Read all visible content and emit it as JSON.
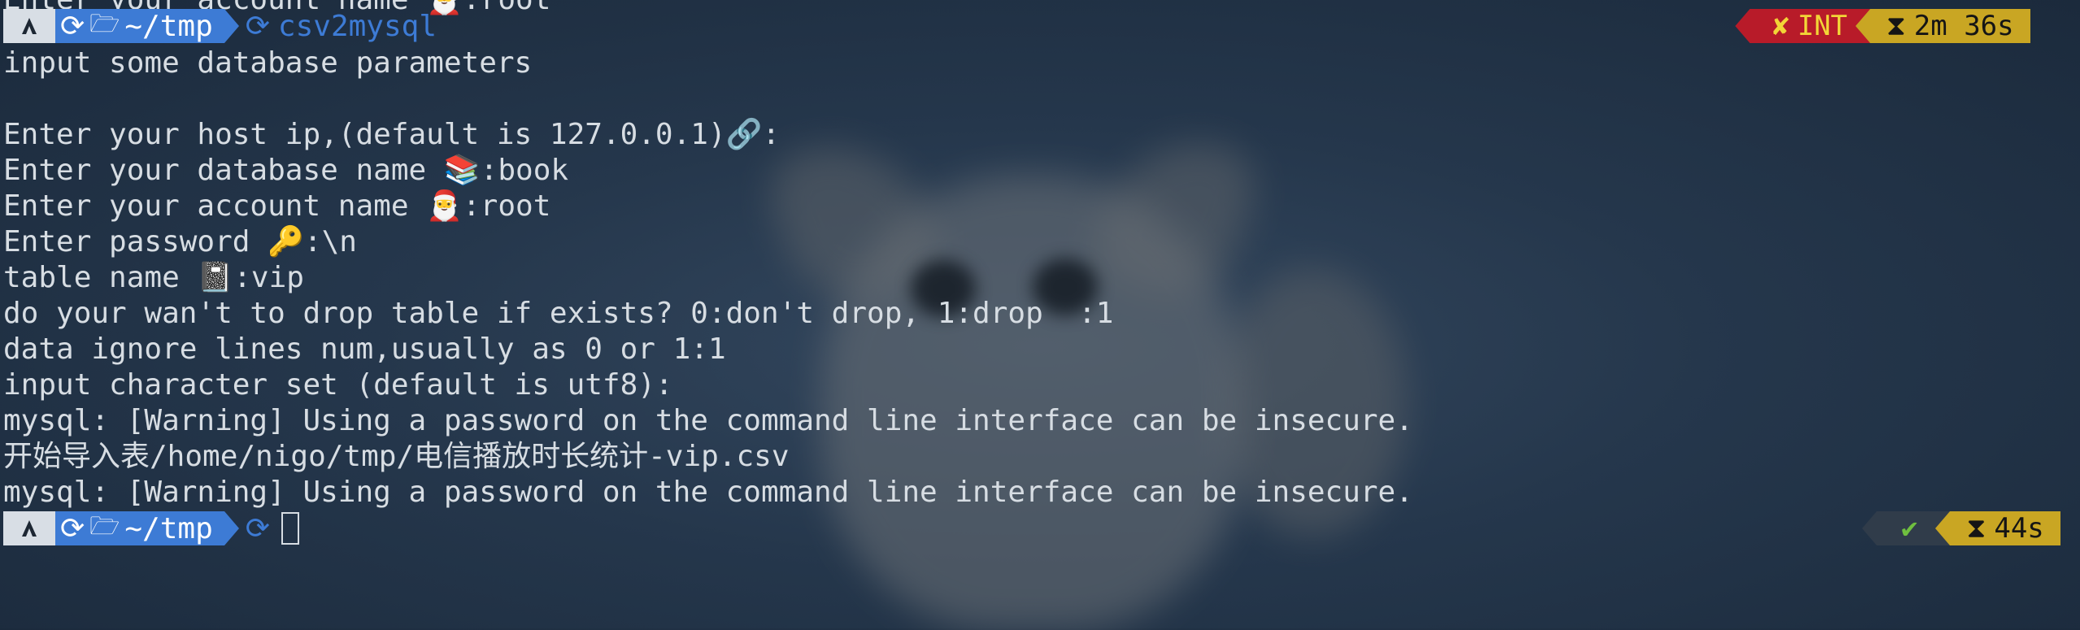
{
  "terminal": {
    "cut_top_line": "Enter your account name 🎅:root",
    "prompt1": {
      "os_icon": "arch-icon",
      "refresh_glyph": "⟳",
      "folder_glyph": "🗁",
      "dir": "~/tmp",
      "git_glyph": "⟳",
      "command": "csv2mysql",
      "status_err_glyph": "✘",
      "status_err": "INT",
      "hourglass_glyph": "⧗",
      "elapsed": "2m 36s"
    },
    "output": [
      "input some database parameters",
      "",
      "Enter your host ip,(default is 127.0.0.1)🔗:",
      "Enter your database name 📚:book",
      "Enter your account name 🎅:root",
      "Enter password 🔑:\\n",
      "table name 📓:vip",
      "do your wan't to drop table if exists? 0:don't drop, 1:drop  :1",
      "data ignore lines num,usually as 0 or 1:1",
      "input character set (default is utf8):",
      "mysql: [Warning] Using a password on the command line interface can be insecure.",
      "开始导入表/home/nigo/tmp/电信播放时长统计-vip.csv",
      "mysql: [Warning] Using a password on the command line interface can be insecure."
    ],
    "prompt2": {
      "os_icon": "arch-icon",
      "refresh_glyph": "⟳",
      "folder_glyph": "🗁",
      "dir": "~/tmp",
      "git_glyph": "⟳",
      "command": "",
      "status_ok_glyph": "✔",
      "hourglass_glyph": "⧗",
      "elapsed": "44s"
    }
  },
  "colors": {
    "dir_bg": "#3d7bd5",
    "err_bg": "#b81b29",
    "time_bg": "#c9a623",
    "ok_fg": "#6fbf3f"
  }
}
